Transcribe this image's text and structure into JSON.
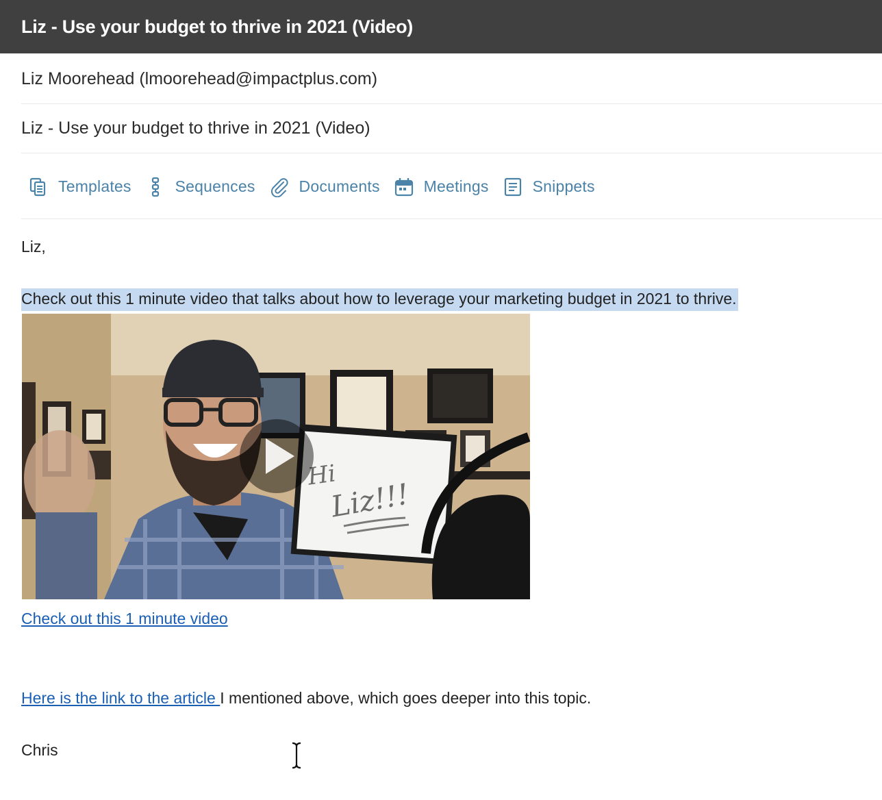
{
  "window": {
    "title": "Liz - Use your budget to thrive in 2021 (Video)"
  },
  "compose": {
    "to": "Liz Moorehead (lmoorehead@impactplus.com)",
    "subject": "Liz - Use your budget to thrive in 2021 (Video)"
  },
  "toolbar": {
    "templates": {
      "label": "Templates",
      "icon": "templates-icon"
    },
    "sequences": {
      "label": "Sequences",
      "icon": "sequences-icon"
    },
    "documents": {
      "label": "Documents",
      "icon": "paperclip-icon"
    },
    "meetings": {
      "label": "Meetings",
      "icon": "calendar-icon"
    },
    "snippets": {
      "label": "Snippets",
      "icon": "snippets-icon"
    }
  },
  "body": {
    "greeting": "Liz,",
    "intro": "Check out this 1 minute video that talks about how to leverage your marketing budget in 2021 to thrive.",
    "video": {
      "whiteboard_text_1": "Hi",
      "whiteboard_text_2": "Liz!!!"
    },
    "video_link": "Check out this 1 minute video",
    "article_link": "Here is the link to the article ",
    "article_text": "I mentioned above, which goes deeper into this topic.",
    "signature": "Chris"
  },
  "colors": {
    "titlebar": "#404040",
    "toolbar_text": "#4a82a8",
    "link": "#1a5fb4",
    "selection": "#c5d9f1"
  }
}
